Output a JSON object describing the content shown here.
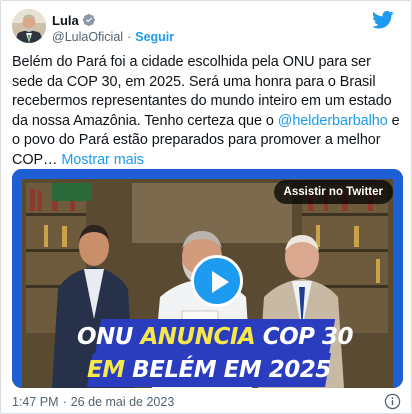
{
  "author": {
    "display_name": "Lula",
    "handle": "@LulaOficial",
    "follow_label": "Seguir",
    "separator": "·"
  },
  "tweet": {
    "text_before_mention": "Belém do Pará foi a cidade escolhida pela ONU para ser sede da COP 30, em 2025. Será uma honra para o Brasil recebermos representantes do mundo inteiro em um estado da nossa Amazônia. Tenho certeza que o ",
    "mention": "@helderbarbalho",
    "text_after_mention": " e o povo do Pará estão preparados para promover a melhor COP…",
    "show_more": "Mostrar mais"
  },
  "media": {
    "watch_label": "Assistir no Twitter",
    "banner_line1_part1": "ONU ",
    "banner_line1_part2": "ANUNCIA ",
    "banner_line1_part3": "COP 30",
    "banner_line2_part1": "EM ",
    "banner_line2_part2": "BELÉM ",
    "banner_line2_part3": "EM 2025"
  },
  "footer": {
    "time": "1:47 PM",
    "separator": "·",
    "date": "26 de mai de 2023"
  },
  "colors": {
    "accent": "#1d9bf0",
    "banner_blue": "#2b3dbf",
    "banner_yellow": "#f6e84a"
  },
  "icons": {
    "verified": "verified-badge-icon",
    "brand": "twitter-bird-icon",
    "play": "play-icon",
    "info": "info-icon"
  }
}
